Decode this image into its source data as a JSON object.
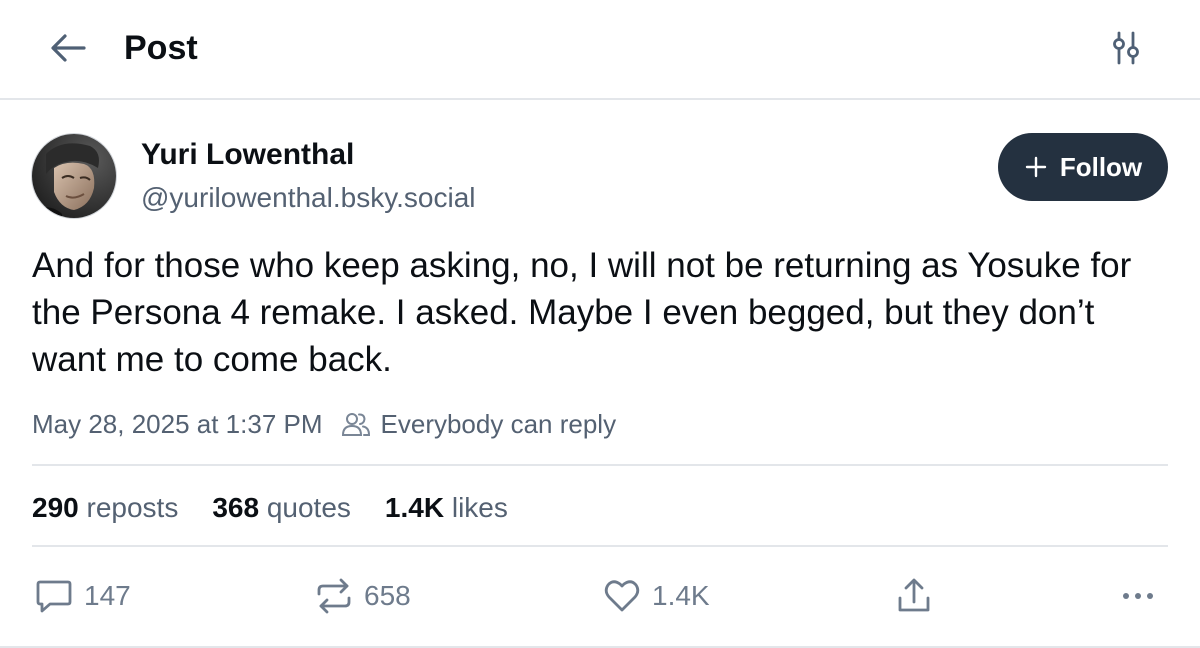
{
  "header": {
    "title": "Post",
    "back_icon": "arrow-left-icon",
    "settings_icon": "sliders-icon"
  },
  "author": {
    "name": "Yuri Lowenthal",
    "handle": "@yurilowenthal.bsky.social"
  },
  "follow_button": {
    "label": "Follow",
    "icon": "plus-icon"
  },
  "post": {
    "text": "And for those who keep asking, no, I will not be returning as Yosuke for the Persona 4 remake. I asked. Maybe I even begged, but they don’t want me to come back.",
    "timestamp": "May 28, 2025 at 1:37 PM",
    "reply_setting": "Everybody can reply"
  },
  "stats": [
    {
      "count": "290",
      "label": "reposts"
    },
    {
      "count": "368",
      "label": "quotes"
    },
    {
      "count": "1.4K",
      "label": "likes"
    }
  ],
  "actions": {
    "reply": {
      "icon": "comment-icon",
      "count": "147"
    },
    "repost": {
      "icon": "repost-icon",
      "count": "658"
    },
    "like": {
      "icon": "heart-icon",
      "count": "1.4K"
    },
    "share": {
      "icon": "share-icon"
    },
    "more": {
      "icon": "more-icon"
    }
  },
  "colors": {
    "text_primary": "#0b0f14",
    "text_secondary": "#546172",
    "icon_gray": "#6e7b8c",
    "follow_bg": "#243140",
    "divider": "#e3e6ea"
  }
}
